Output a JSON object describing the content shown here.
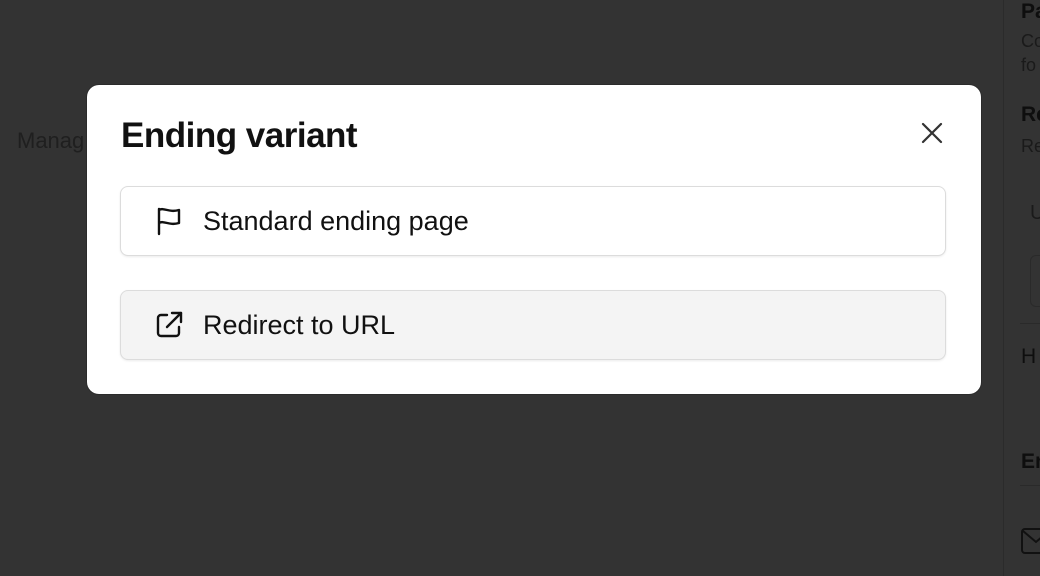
{
  "background": {
    "left_text": "Manag",
    "right_panel": {
      "title1": "Pa",
      "sub1_line1": "Co",
      "sub1_line2": "fo",
      "title2": "Re",
      "sub2": "Re",
      "label1": "U",
      "title3": "H",
      "title4": "En"
    }
  },
  "modal": {
    "title": "Ending variant",
    "close_icon": "close-icon",
    "options": [
      {
        "label": "Standard ending page",
        "icon": "flag-icon"
      },
      {
        "label": "Redirect to URL",
        "icon": "external-link-icon"
      }
    ]
  },
  "colors": {
    "overlay": "#333333",
    "modal_bg": "#ffffff",
    "option_hover_bg": "#f4f4f4",
    "text": "#111111"
  }
}
